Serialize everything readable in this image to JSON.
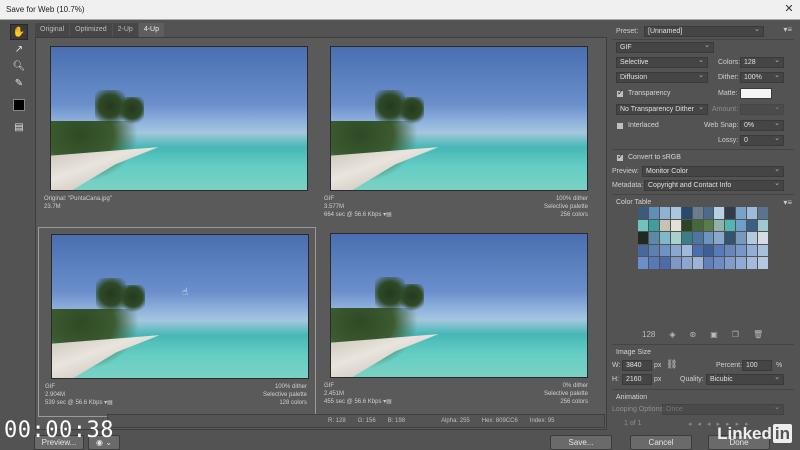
{
  "window": {
    "title": "Save for Web (10.7%)"
  },
  "tabs": [
    {
      "label": "Original",
      "active": false
    },
    {
      "label": "Optimized",
      "active": false
    },
    {
      "label": "2-Up",
      "active": false
    },
    {
      "label": "4-Up",
      "active": true
    }
  ],
  "tools": [
    "hand-tool",
    "slice-select-tool",
    "zoom-tool",
    "eyedropper-tool"
  ],
  "panes": [
    {
      "l1": "Original: \"PuntaCana.jpg\"",
      "l2": "23.7M",
      "l3": "",
      "r1": "",
      "r2": "",
      "r3": ""
    },
    {
      "l1": "GIF",
      "l2": "3.577M",
      "l3": "664 sec @ 56.6 Kbps",
      "r1": "100% dither",
      "r2": "Selective palette",
      "r3": "256 colors"
    },
    {
      "l1": "GIF",
      "l2": "2.904M",
      "l3": "539 sec @ 56.6 Kbps",
      "r1": "100% dither",
      "r2": "Selective palette",
      "r3": "128 colors"
    },
    {
      "l1": "GIF",
      "l2": "2.451M",
      "l3": "455 sec @ 56.6 Kbps",
      "r1": "0% dither",
      "r2": "Selective palette",
      "r3": "256 colors"
    }
  ],
  "status": {
    "r": "R: 128",
    "g": "G: 156",
    "b": "B: 198",
    "alpha": "Alpha: 255",
    "hex": "Hex: 809CC6",
    "index": "Index: 95"
  },
  "panel": {
    "preset_label": "Preset:",
    "preset_value": "[Unnamed]",
    "format": "GIF",
    "reduction": "Selective",
    "colors_label": "Colors:",
    "colors_value": "128",
    "dither_algo": "Diffusion",
    "dither_label": "Dither:",
    "dither_value": "100%",
    "transparency_label": "Transparency",
    "matte_label": "Matte:",
    "trans_dither": "No Transparency Dither",
    "amount_label": "Amount:",
    "interlaced_label": "Interlaced",
    "websnap_label": "Web Snap:",
    "websnap_value": "0%",
    "lossy_label": "Lossy:",
    "lossy_value": "0",
    "srgb_label": "Convert to sRGB",
    "preview_label": "Preview:",
    "preview_value": "Monitor Color",
    "metadata_label": "Metadata:",
    "metadata_value": "Copyright and Contact Info",
    "color_table_title": "Color Table",
    "color_count": "128",
    "image_size_title": "Image Size",
    "w_label": "W:",
    "w_value": "3840",
    "h_label": "H:",
    "h_value": "2160",
    "px": "px",
    "percent_label": "Percent:",
    "percent_value": "100",
    "percent_unit": "%",
    "quality_label": "Quality:",
    "quality_value": "Bicubic",
    "animation_title": "Animation",
    "looping_label": "Looping Options:",
    "looping_value": "Once",
    "frame_counter": "1 of 1"
  },
  "buttons": {
    "preview": "Preview...",
    "save": "Save...",
    "cancel": "Cancel",
    "done": "Done"
  },
  "overlay": {
    "timecode": "00:00:38",
    "watermark": "Linked",
    "watermark_in": "in"
  },
  "palette": [
    "#3c5a7a",
    "#5d8fb8",
    "#8fb2d4",
    "#a8c7e0",
    "#274a6b",
    "#6a7f8e",
    "#4b6b8a",
    "#b7d0e4",
    "#2f3c4a",
    "#7aa1c7",
    "#9bbdd9",
    "#5a7390",
    "#6fc4bd",
    "#3e9e9b",
    "#c7c2b6",
    "#e5e1da",
    "#2c4526",
    "#46673c",
    "#587d4a",
    "#8fb3a8",
    "#4fb6b3",
    "#6ca0c9",
    "#3a5f84",
    "#9dc9d0",
    "#1e2a22",
    "#5b8aa8",
    "#7fb8c6",
    "#a5d3cc",
    "#3b7e86",
    "#4d76a2",
    "#6a94c2",
    "#8aa8cc",
    "#33546f",
    "#7699bd",
    "#b3c9dc",
    "#d4dde3",
    "#47689a",
    "#5d80b3",
    "#7091c4",
    "#88a8d2",
    "#9fb9dc",
    "#4a6fb1",
    "#3d5e96",
    "#587ab8",
    "#6785be",
    "#7797c9",
    "#92aed6",
    "#a8c0de",
    "#6a8fcb",
    "#5779b8",
    "#4b6ca8",
    "#7b99c8",
    "#8ca6d0",
    "#9cb4d8",
    "#5f80bc",
    "#6c8cc4",
    "#7f9dcc",
    "#90acd4",
    "#a3bcdb",
    "#b4c8e1"
  ]
}
